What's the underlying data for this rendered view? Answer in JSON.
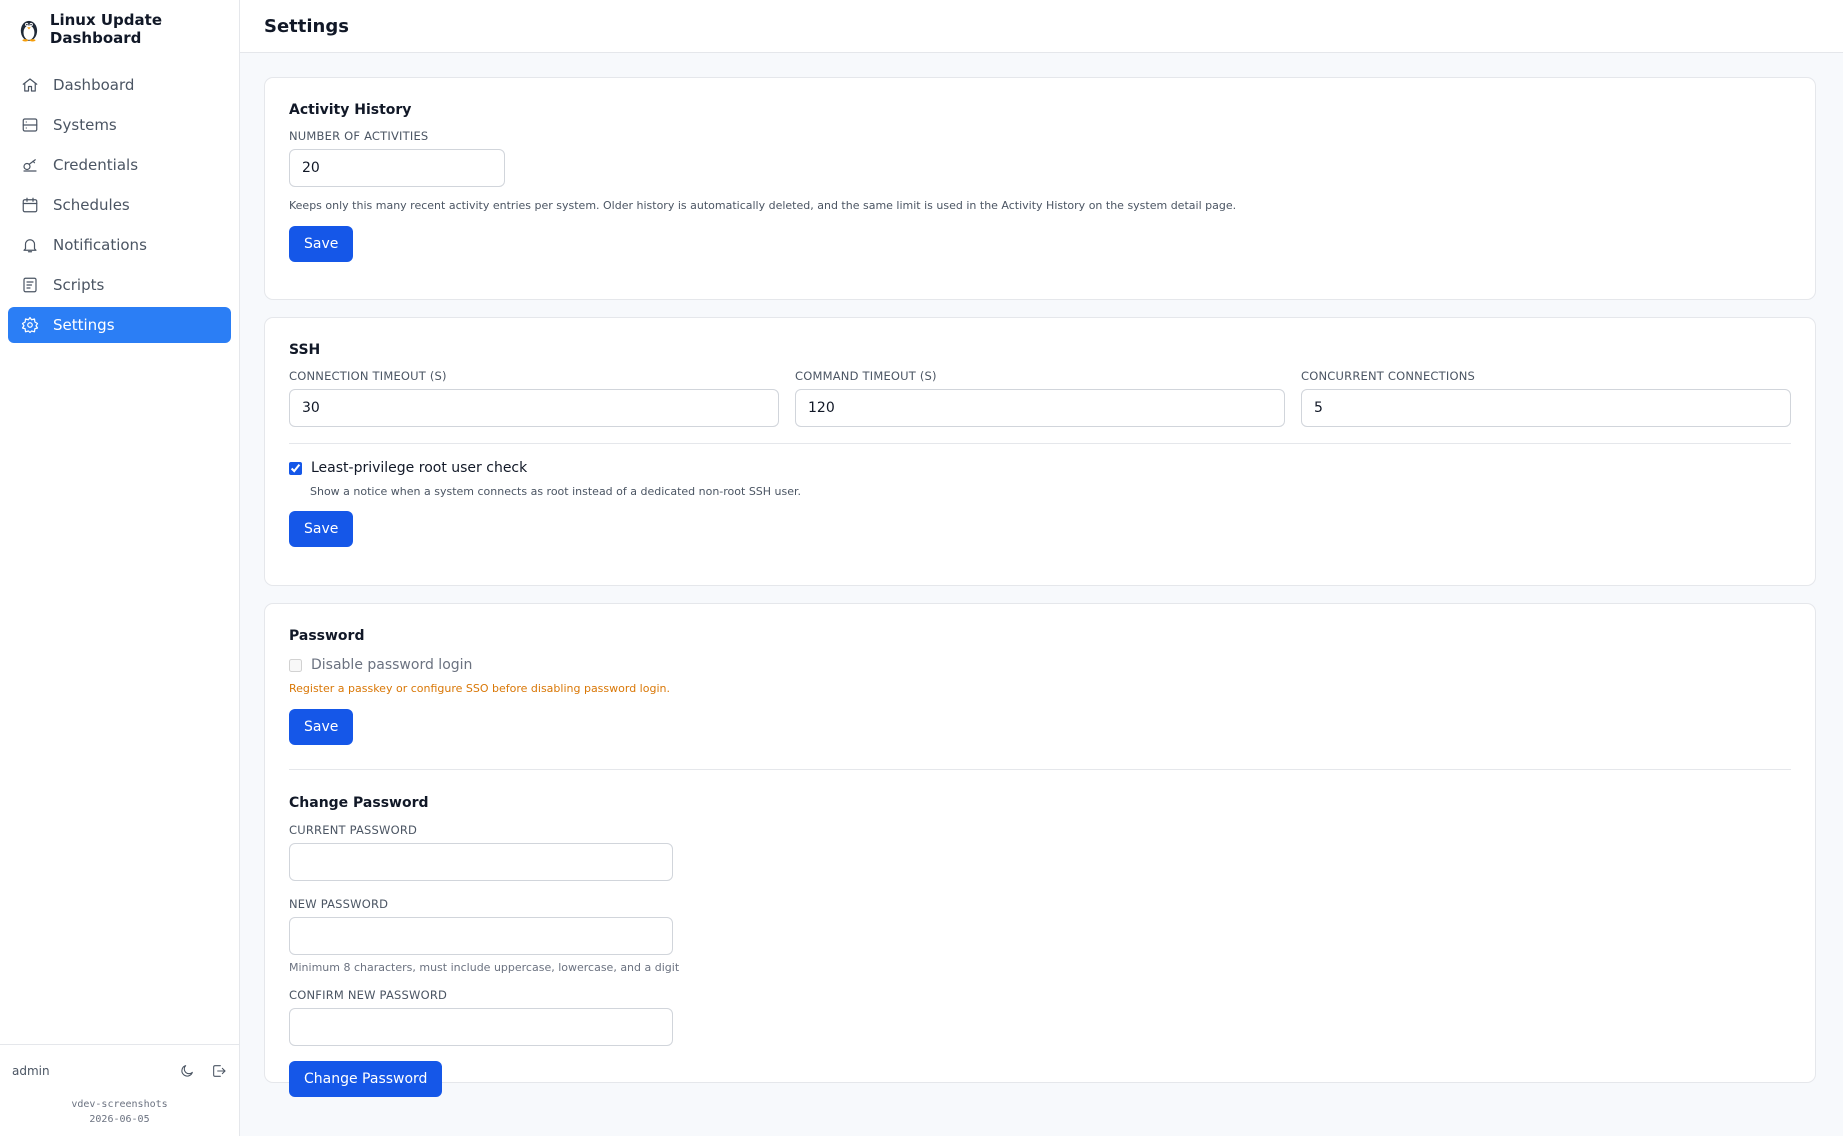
{
  "app": {
    "title": "Linux Update Dashboard"
  },
  "sidebar": {
    "items": [
      {
        "label": "Dashboard",
        "icon": "home-icon"
      },
      {
        "label": "Systems",
        "icon": "server-icon"
      },
      {
        "label": "Credentials",
        "icon": "key-icon"
      },
      {
        "label": "Schedules",
        "icon": "calendar-icon"
      },
      {
        "label": "Notifications",
        "icon": "bell-icon"
      },
      {
        "label": "Scripts",
        "icon": "file-text-icon"
      },
      {
        "label": "Settings",
        "icon": "gear-icon",
        "active": true
      }
    ],
    "footer": {
      "user": "admin",
      "build_name": "vdev-screenshots",
      "build_date": "2026-06-05"
    }
  },
  "header": {
    "title": "Settings"
  },
  "activity": {
    "title": "Activity History",
    "count_label": "NUMBER OF ACTIVITIES",
    "count_value": "20",
    "hint": "Keeps only this many recent activity entries per system. Older history is automatically deleted, and the same limit is used in the Activity History on the system detail page.",
    "save_label": "Save"
  },
  "ssh": {
    "title": "SSH",
    "conn_timeout_label": "CONNECTION TIMEOUT (S)",
    "conn_timeout_value": "30",
    "cmd_timeout_label": "COMMAND TIMEOUT (S)",
    "cmd_timeout_value": "120",
    "concurrent_label": "CONCURRENT CONNECTIONS",
    "concurrent_value": "5",
    "root_check_label": "Least-privilege root user check",
    "root_check_checked": true,
    "root_check_hint": "Show a notice when a system connects as root instead of a dedicated non-root SSH user.",
    "save_label": "Save"
  },
  "password": {
    "title": "Password",
    "disable_label": "Disable password login",
    "disable_checked": false,
    "warning": "Register a passkey or configure SSO before disabling password login.",
    "save_label": "Save",
    "change_title": "Change Password",
    "current_label": "CURRENT PASSWORD",
    "new_label": "NEW PASSWORD",
    "new_hint": "Minimum 8 characters, must include uppercase, lowercase, and a digit",
    "confirm_label": "CONFIRM NEW PASSWORD",
    "change_button": "Change Password"
  },
  "colors": {
    "accent": "#1557e8",
    "active_nav": "#2b7ef5",
    "warning": "#d97706"
  }
}
